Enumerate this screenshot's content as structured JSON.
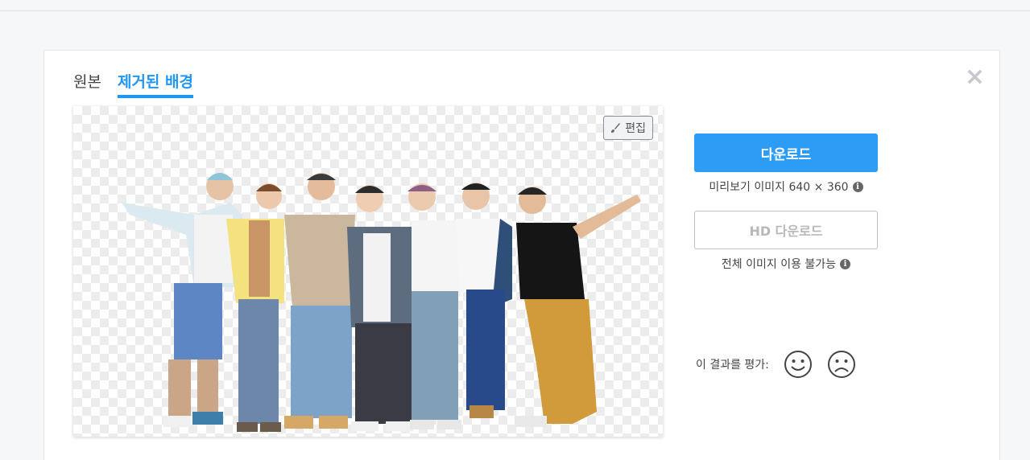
{
  "tabs": {
    "original": "원본",
    "removed": "제거된 배경"
  },
  "close_label": "×",
  "edit": {
    "label": "편집",
    "icon": "brush-icon"
  },
  "download": {
    "label": "다운로드",
    "preview_info": "미리보기 이미지 640 × 360",
    "hd_label": "HD 다운로드",
    "hd_info": "전체 이미지 이용 불가능"
  },
  "rating": {
    "label": "이 결과를 평가:"
  },
  "colors": {
    "accent": "#2d9cf4",
    "tab_active": "#2196f3"
  }
}
